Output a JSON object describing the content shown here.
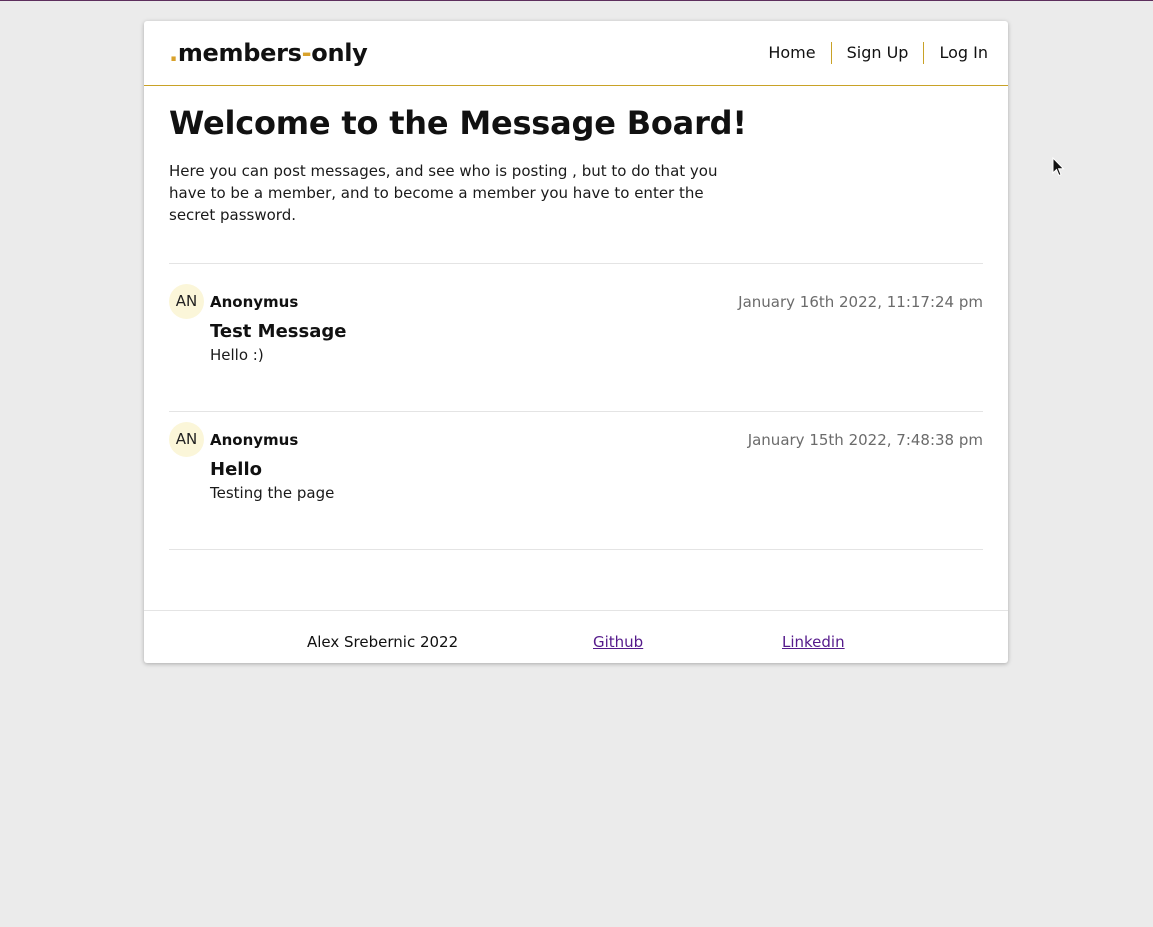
{
  "header": {
    "logo": {
      "dot": ".",
      "word1": "members",
      "dash": "-",
      "word2": "only"
    },
    "nav": [
      {
        "label": "Home"
      },
      {
        "label": "Sign Up"
      },
      {
        "label": "Log In"
      }
    ]
  },
  "main": {
    "title": "Welcome to the Message Board!",
    "intro": "Here you can post messages, and see who is posting , but to do that you have to be a member, and to become a member you have to enter the secret password.",
    "messages": [
      {
        "initials": "AN",
        "author": "Anonymus",
        "timestamp": "January 16th 2022, 11:17:24 pm",
        "title": "Test Message",
        "body": "Hello :)"
      },
      {
        "initials": "AN",
        "author": "Anonymus",
        "timestamp": "January 15th 2022, 7:48:38 pm",
        "title": "Hello",
        "body": "Testing the page"
      }
    ]
  },
  "footer": {
    "copyright": "Alex Srebernic 2022",
    "github_label": "Github",
    "linkedin_label": "Linkedin"
  },
  "colors": {
    "accent": "#d9a22b",
    "background": "#ebebeb",
    "avatar_bg": "#fbf6d9",
    "link_visited": "#551a8b"
  },
  "icons": {
    "cursor": "mouse-pointer-icon"
  }
}
